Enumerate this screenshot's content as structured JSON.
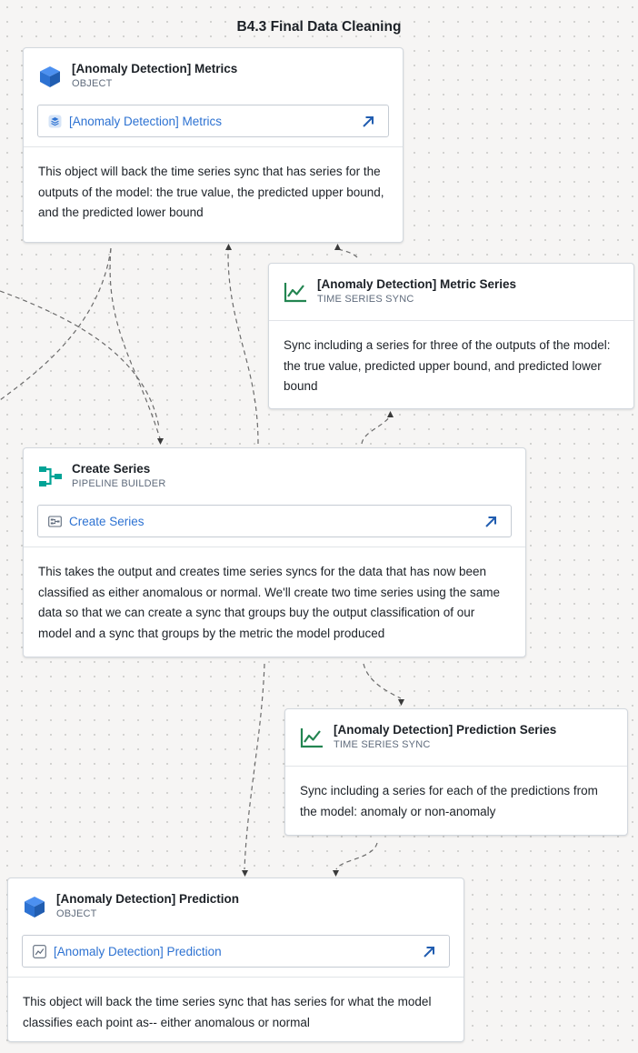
{
  "section_title": "B4.3 Final Data Cleaning",
  "colors": {
    "object_icon": "#2d72d2",
    "time_series_icon": "#238551",
    "pipeline_icon": "#00a396",
    "link_text": "#2d72d2",
    "edge": "#6b6b6b"
  },
  "nodes": {
    "metrics_object": {
      "title": "[Anomaly Detection] Metrics",
      "type": "OBJECT",
      "icon": "cube-icon",
      "link_label": "[Anomaly Detection] Metrics",
      "link_icon": "object-stack-icon",
      "description": "This object will back the time series sync that has series for the outputs of the model: the true value, the predicted upper bound, and the predicted lower bound"
    },
    "metric_series_sync": {
      "title": "[Anomaly Detection] Metric Series",
      "type": "TIME SERIES SYNC",
      "icon": "line-chart-icon",
      "description": "Sync including a series for three of the outputs of the model: the true value, predicted upper bound, and predicted lower bound"
    },
    "create_series": {
      "title": "Create Series",
      "type": "PIPELINE BUILDER",
      "icon": "pipeline-icon",
      "link_label": "Create Series",
      "link_icon": "pipeline-file-icon",
      "description": "This takes the output and creates time series syncs for the data that has now been classified as either anomalous or normal. We'll create two time series using the same data so that we can create a sync that groups buy the output classification of our model and a sync that groups by the metric the model produced"
    },
    "prediction_series_sync": {
      "title": "[Anomaly Detection] Prediction Series",
      "type": "TIME SERIES SYNC",
      "icon": "line-chart-icon",
      "description": "Sync including a series for each of the predictions from the model: anomaly or non-anomaly"
    },
    "prediction_object": {
      "title": "[Anomaly Detection] Prediction",
      "type": "OBJECT",
      "icon": "cube-icon",
      "link_label": "[Anomaly Detection] Prediction",
      "link_icon": "chart-file-icon",
      "description": "This object will back the time series sync that has series for what the model classifies each point as-- either anomalous or normal"
    }
  }
}
